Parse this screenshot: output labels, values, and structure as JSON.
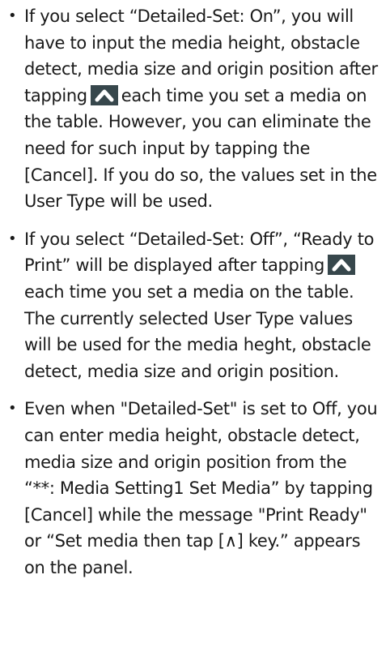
{
  "bullet_glyph": "•",
  "colors": {
    "text": "#1a1a1a",
    "icon_background": "#37474c",
    "icon_chevron": "#ffffff"
  },
  "icons": {
    "up_key": "up-arrow-key-icon"
  },
  "bullets": [
    {
      "part1": "If you select “Detailed-Set: On”, you will have to input the media height, obstacle detect, media size and origin position after tapping",
      "part2": "each time you set a media on the table. However, you can eliminate the need for such input by tapping the [Cancel]. If you do so, the values set in the User Type will be used."
    },
    {
      "part1": "If you select “Detailed-Set: Off”, “Ready to Print” will be displayed after tapping",
      "part2": "each time you set a media on the table.",
      "para2": "The currently selected User Type values will be used for the media heght, obstacle detect, media size and origin position."
    },
    {
      "text": "Even when \"Detailed-Set\" is set to Off, you can enter media height, obstacle detect, media size and origin position from the “**: Media Setting1 Set Media” by tapping [Cancel] while the message \"Print Ready\" or “Set media then tap [∧] key.” appears on the panel."
    }
  ]
}
